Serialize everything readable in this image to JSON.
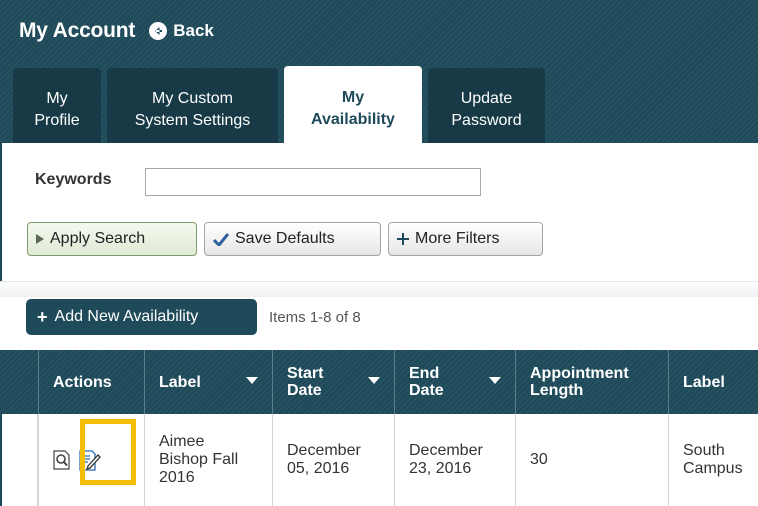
{
  "header": {
    "title": "My Account",
    "back_label": "Back"
  },
  "tabs": [
    {
      "line1": "My",
      "line2": "Profile",
      "active": false
    },
    {
      "line1": "My Custom",
      "line2": "System Settings",
      "active": false
    },
    {
      "line1": "My",
      "line2": "Availability",
      "active": true
    },
    {
      "line1": "Update",
      "line2": "Password",
      "active": false
    }
  ],
  "search": {
    "keywords_label": "Keywords",
    "keywords_value": "",
    "keywords_placeholder": "",
    "apply_label": "Apply Search",
    "save_defaults_label": "Save Defaults",
    "more_filters_label": "More Filters"
  },
  "list": {
    "add_label": "Add New Availability",
    "items_count": "Items 1-8 of 8"
  },
  "table": {
    "headers": {
      "actions": "Actions",
      "label": "Label",
      "start_line1": "Start",
      "start_line2": "Date",
      "end_line1": "End",
      "end_line2": "Date",
      "appt_line1": "Appointment",
      "appt_line2": "Length",
      "label2": "Label"
    },
    "rows": [
      {
        "label_l1": "Aimee",
        "label_l2": "Bishop Fall",
        "label_l3": "2016",
        "start_l1": "December",
        "start_l2": "05, 2016",
        "end_l1": "December",
        "end_l2": "23, 2016",
        "appointment_length": "30",
        "label2_l1": "South",
        "label2_l2": "Campus"
      }
    ]
  },
  "colors": {
    "primary": "#1f4a5a",
    "highlight": "#f5be0b"
  },
  "icons": [
    "back-arrow-icon",
    "play-icon",
    "checkmark-icon",
    "plus-icon",
    "view-icon",
    "edit-icon",
    "sort-arrow-icon"
  ]
}
